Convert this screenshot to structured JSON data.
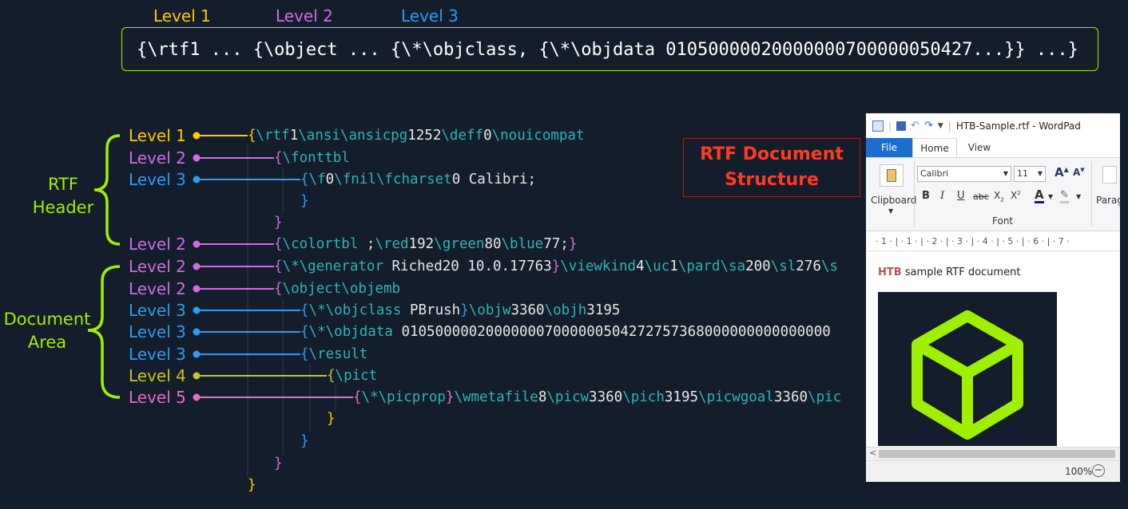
{
  "top_levels": [
    "Level 1",
    "Level 2",
    "Level 3"
  ],
  "top_code": "{\\rtf1 ... {\\object ... {\\*\\objclass, {\\*\\objdata 01050000020000000700000050427...}} ...}",
  "sections": {
    "header": [
      "RTF",
      "Header"
    ],
    "document": [
      "Document",
      "Area"
    ]
  },
  "tree": [
    {
      "label": "Level 1",
      "tokens": [
        [
          "p",
          "{"
        ],
        [
          "k",
          "\\rtf"
        ],
        [
          "t",
          "1"
        ],
        [
          "k",
          "\\ansi\\ansicpg"
        ],
        [
          "t",
          "1252"
        ],
        [
          "k",
          "\\deff"
        ],
        [
          "t",
          "0"
        ],
        [
          "k",
          "\\nouicompat"
        ]
      ]
    },
    {
      "label": "Level 2",
      "tokens": [
        [
          "p",
          "{"
        ],
        [
          "k",
          "\\fonttbl"
        ]
      ]
    },
    {
      "label": "Level 3",
      "tokens": [
        [
          "p",
          "{"
        ],
        [
          "k",
          "\\f"
        ],
        [
          "t",
          "0"
        ],
        [
          "k",
          "\\fnil\\fcharset"
        ],
        [
          "t",
          "0 Calibri;"
        ]
      ]
    },
    {
      "label": "",
      "tokens": [
        [
          "p",
          "}"
        ]
      ]
    },
    {
      "label": "",
      "tokens": [
        [
          "p",
          "}"
        ]
      ]
    },
    {
      "label": "Level 2",
      "tokens": [
        [
          "p",
          "{"
        ],
        [
          "k",
          "\\colortbl "
        ],
        [
          "t",
          ";"
        ],
        [
          "k",
          "\\red"
        ],
        [
          "t",
          "192"
        ],
        [
          "k",
          "\\green"
        ],
        [
          "t",
          "80"
        ],
        [
          "k",
          "\\blue"
        ],
        [
          "t",
          "77;"
        ],
        [
          "p",
          "}"
        ]
      ]
    },
    {
      "label": "Level 2",
      "tokens": [
        [
          "p",
          "{"
        ],
        [
          "k",
          "\\*\\generator "
        ],
        [
          "t",
          "Riched20 10.0.17763"
        ],
        [
          "p",
          "}"
        ],
        [
          "k",
          "\\viewkind"
        ],
        [
          "t",
          "4"
        ],
        [
          "k",
          "\\uc"
        ],
        [
          "t",
          "1"
        ],
        [
          "k",
          "\\pard\\sa"
        ],
        [
          "t",
          "200"
        ],
        [
          "k",
          "\\sl"
        ],
        [
          "t",
          "276"
        ],
        [
          "k",
          "\\s"
        ]
      ]
    },
    {
      "label": "Level 2",
      "tokens": [
        [
          "p",
          "{"
        ],
        [
          "k",
          "\\object\\objemb"
        ]
      ]
    },
    {
      "label": "Level 3",
      "tokens": [
        [
          "p",
          "{"
        ],
        [
          "k",
          "\\*\\objclass "
        ],
        [
          "t",
          "PBrush"
        ],
        [
          "p",
          "}"
        ],
        [
          "k",
          "\\objw"
        ],
        [
          "t",
          "3360"
        ],
        [
          "k",
          "\\objh"
        ],
        [
          "t",
          "3195"
        ]
      ]
    },
    {
      "label": "Level 3",
      "tokens": [
        [
          "p",
          "{"
        ],
        [
          "k",
          "\\*\\objdata "
        ],
        [
          "t",
          "010500000200000007000000504272757368000000000000000"
        ]
      ]
    },
    {
      "label": "Level 3",
      "tokens": [
        [
          "p",
          "{"
        ],
        [
          "k",
          "\\result"
        ]
      ]
    },
    {
      "label": "Level 4",
      "tokens": [
        [
          "p",
          "{"
        ],
        [
          "k",
          "\\pict"
        ]
      ]
    },
    {
      "label": "Level 5",
      "tokens": [
        [
          "p",
          "{"
        ],
        [
          "k",
          "\\*\\picprop"
        ],
        [
          "p",
          "}"
        ],
        [
          "k",
          "\\wmetafile"
        ],
        [
          "t",
          "8"
        ],
        [
          "k",
          "\\picw"
        ],
        [
          "t",
          "3360"
        ],
        [
          "k",
          "\\pich"
        ],
        [
          "t",
          "3195"
        ],
        [
          "k",
          "\\picwgoal"
        ],
        [
          "t",
          "3360"
        ],
        [
          "k",
          "\\pic"
        ]
      ]
    },
    {
      "label": "",
      "tokens": [
        [
          "p",
          "}"
        ]
      ]
    },
    {
      "label": "",
      "tokens": [
        [
          "p",
          "}"
        ]
      ]
    },
    {
      "label": "",
      "tokens": [
        [
          "p",
          "}"
        ]
      ]
    },
    {
      "label": "",
      "tokens": [
        [
          "p",
          "}"
        ]
      ]
    }
  ],
  "title_box": [
    "RTF Document",
    "Structure"
  ],
  "colors": {
    "level1": "#ffc900",
    "level2": "#cf6ce2",
    "level3": "#2b9cf0",
    "level4": "#c6c620",
    "level5": "#e070c8",
    "keyword": "#2fb3b9",
    "accent": "#9fef00",
    "title": "#ff3b1f"
  },
  "wordpad": {
    "title": "HTB-Sample.rtf - WordPad",
    "tabs": [
      "File",
      "Home",
      "View"
    ],
    "clipboard_label": "Clipboard",
    "font_name": "Calibri",
    "font_size": "11",
    "font_group_label": "Font",
    "paragraph_label": "Parag",
    "ruler": "· 1 · | · 1 · | · 2 · | · 3 · | · 4 · | · 5 · | · 6 · | · 7 ·",
    "doc_prefix": "HTB",
    "doc_text": " sample RTF document",
    "zoom": "100%",
    "logo_icon": "htb-cube-icon"
  }
}
